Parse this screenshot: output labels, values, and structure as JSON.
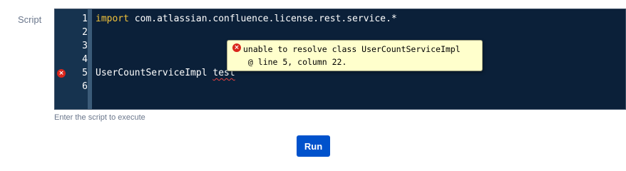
{
  "form": {
    "script_label": "Script",
    "help_text": "Enter the script to execute",
    "run_label": "Run"
  },
  "editor": {
    "line_numbers": [
      "1",
      "2",
      "3",
      "4",
      "5",
      "6"
    ],
    "lines": {
      "l1_keyword": "import",
      "l1_rest": " com.atlassian.confluence.license.rest.service.*",
      "l5_text": "UserCountServiceImpl ",
      "l5_error_token": "test"
    },
    "error_line": "5"
  },
  "tooltip": {
    "message": "unable to resolve class UserCountServiceImpl",
    "location": " @ line 5, column 22."
  },
  "icons": {
    "gutter_error": "error-circle-icon",
    "tooltip_error": "error-circle-icon"
  },
  "colors": {
    "editor_bg": "#0b2039",
    "keyword": "#f3c33a",
    "error": "#d9261c",
    "tooltip_bg": "#ffffcc",
    "button_bg": "#0052cc"
  }
}
